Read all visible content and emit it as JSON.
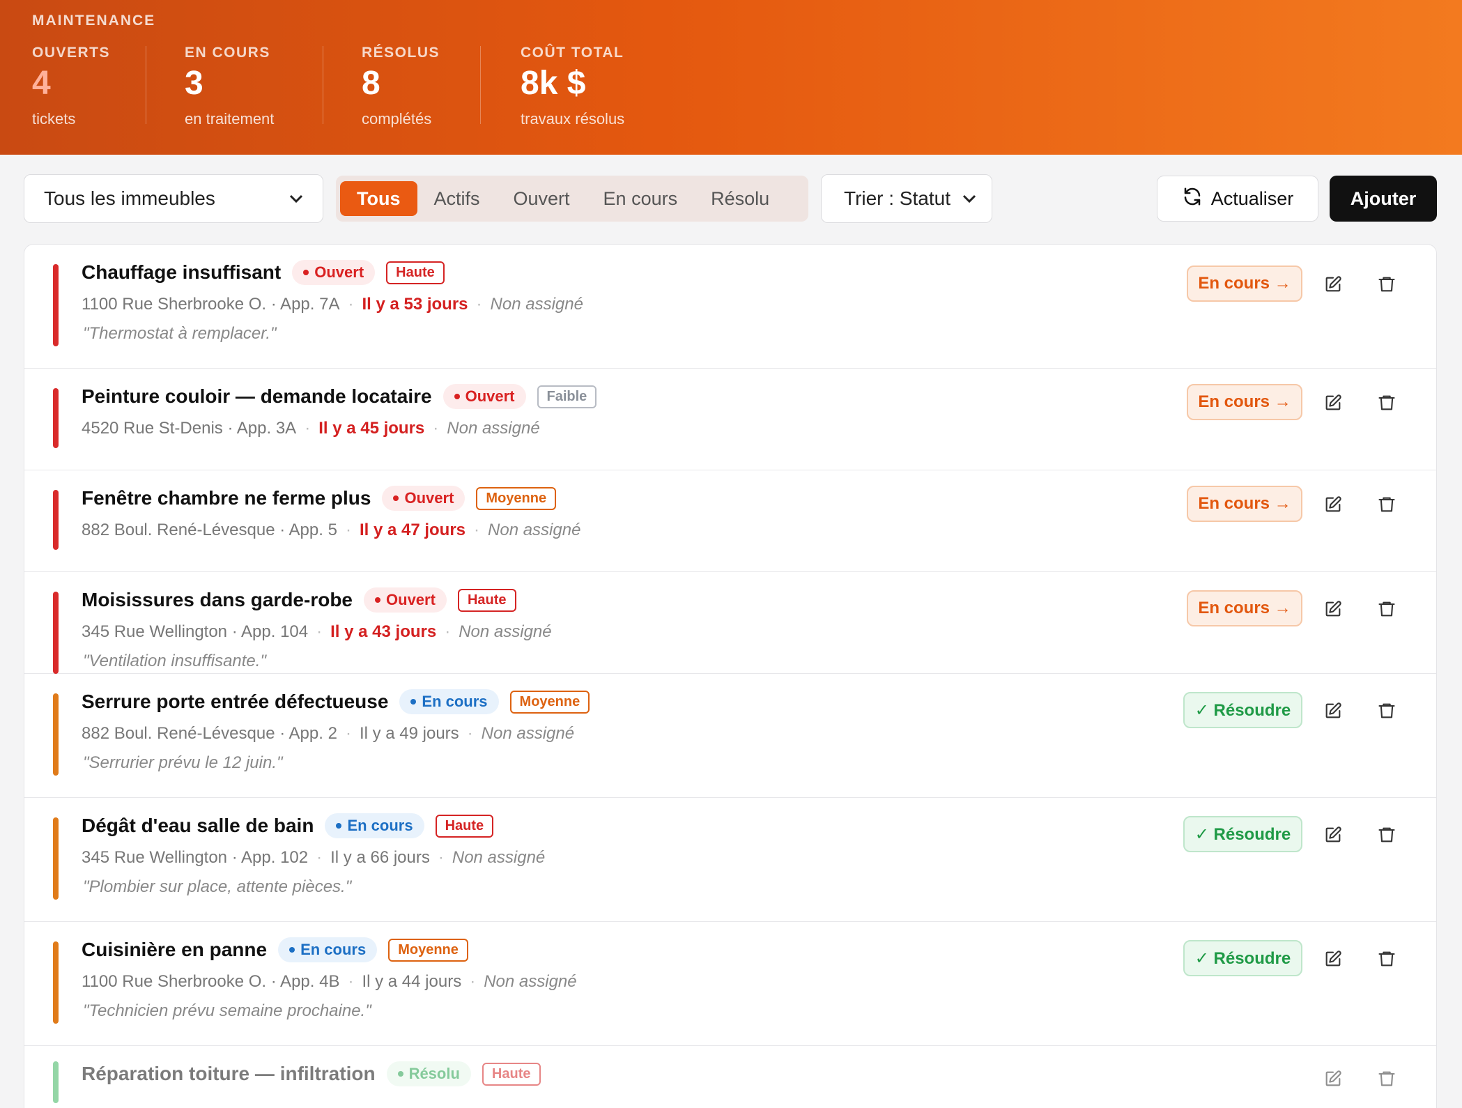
{
  "header": {
    "section_label": "MAINTENANCE",
    "stats": [
      {
        "label": "OUVERTS",
        "value": "4",
        "sub": "tickets",
        "value_color": "#ffb19a"
      },
      {
        "label": "EN COURS",
        "value": "3",
        "sub": "en traitement",
        "value_color": "#ffffff"
      },
      {
        "label": "RÉSOLUS",
        "value": "8",
        "sub": "complétés",
        "value_color": "#ffffff"
      },
      {
        "label": "COÛT TOTAL",
        "value": "8k $",
        "sub": "travaux résolus",
        "value_color": "#ffffff"
      }
    ]
  },
  "toolbar": {
    "building_filter": "Tous les immeubles",
    "tabs": [
      "Tous",
      "Actifs",
      "Ouvert",
      "En cours",
      "Résolu"
    ],
    "active_tab": "Tous",
    "sort_select": "Trier : Statut",
    "refresh_label": "Actualiser",
    "add_label": "Ajouter"
  },
  "tickets": [
    {
      "title": "Chauffage insuffisant",
      "status": "Ouvert",
      "priority": "Haute",
      "address": "1100 Rue Sherbrooke O. · App. 7A",
      "age": "Il y a 53 jours",
      "assignee": "Non assigné",
      "note": "\"Thermostat à remplacer.\"",
      "action": "En cours →"
    },
    {
      "title": "Peinture couloir — demande locataire",
      "status": "Ouvert",
      "priority": "Faible",
      "address": "4520 Rue St-Denis · App. 3A",
      "age": "Il y a 45 jours",
      "assignee": "Non assigné",
      "note": "",
      "action": "En cours →"
    },
    {
      "title": "Fenêtre chambre ne ferme plus",
      "status": "Ouvert",
      "priority": "Moyenne",
      "address": "882 Boul. René-Lévesque · App. 5",
      "age": "Il y a 47 jours",
      "assignee": "Non assigné",
      "note": "",
      "action": "En cours →"
    },
    {
      "title": "Moisissures dans garde-robe",
      "status": "Ouvert",
      "priority": "Haute",
      "address": "345 Rue Wellington · App. 104",
      "age": "Il y a 43 jours",
      "assignee": "Non assigné",
      "note": "\"Ventilation insuffisante.\"",
      "action": "En cours →"
    },
    {
      "title": "Serrure porte entrée défectueuse",
      "status": "En cours",
      "priority": "Moyenne",
      "address": "882 Boul. René-Lévesque · App. 2",
      "age": "Il y a 49 jours",
      "assignee": "Non assigné",
      "note": "\"Serrurier prévu le 12 juin.\"",
      "action": "✓ Résoudre"
    },
    {
      "title": "Dégât d'eau salle de bain",
      "status": "En cours",
      "priority": "Haute",
      "address": "345 Rue Wellington · App. 102",
      "age": "Il y a 66 jours",
      "assignee": "Non assigné",
      "note": "\"Plombier sur place, attente pièces.\"",
      "action": "✓ Résoudre"
    },
    {
      "title": "Cuisinière en panne",
      "status": "En cours",
      "priority": "Moyenne",
      "address": "1100 Rue Sherbrooke O. · App. 4B",
      "age": "Il y a 44 jours",
      "assignee": "Non assigné",
      "note": "\"Technicien prévu semaine prochaine.\"",
      "action": "✓ Résoudre"
    },
    {
      "title": "Réparation toiture — infiltration",
      "status": "Résolu",
      "priority": "Haute",
      "address": "",
      "age": "",
      "assignee": "",
      "note": "",
      "action": ""
    }
  ],
  "colors": {
    "accent": "#ea5a12",
    "open_bar": "#d92b2b",
    "progress_bar": "#e07b1a",
    "resolved_bar": "#3cb55e"
  }
}
